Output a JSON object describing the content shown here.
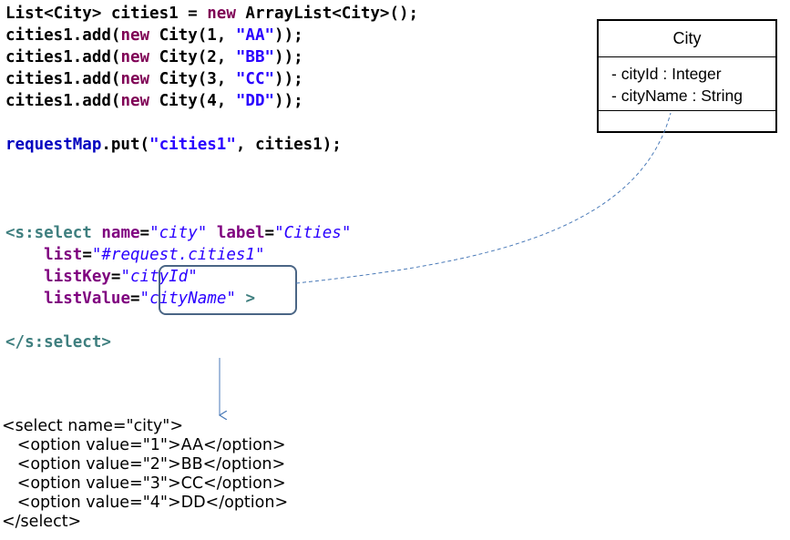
{
  "java": {
    "line1": {
      "a": "List<City> cities1 = ",
      "kw": "new",
      "b": " ArrayList<City>();"
    },
    "adds": [
      {
        "pre": "cities1.add(",
        "kw": "new",
        "mid": " City(1, ",
        "str": "\"AA\"",
        "post": "));"
      },
      {
        "pre": "cities1.add(",
        "kw": "new",
        "mid": " City(2, ",
        "str": "\"BB\"",
        "post": "));"
      },
      {
        "pre": "cities1.add(",
        "kw": "new",
        "mid": " City(3, ",
        "str": "\"CC\"",
        "post": "));"
      },
      {
        "pre": "cities1.add(",
        "kw": "new",
        "mid": " City(4, ",
        "str": "\"DD\"",
        "post": "));"
      }
    ],
    "put": {
      "var": "requestMap",
      "a": ".put(",
      "str": "\"cities1\"",
      "b": ", cities1);"
    }
  },
  "jsp": {
    "open_tag": "<s:select",
    "name_attr": "name",
    "name_val": "\"city\"",
    "label_attr": "label",
    "label_val": "\"Cities\"",
    "list_attr": "list",
    "list_val": "\"#request.cities1\"",
    "listkey_attr": "listKey",
    "listkey_val": "\"cityId\"",
    "listvalue_attr": "listValue",
    "listvalue_val": "\"cityName\"",
    "tag_end": ">",
    "close_tag": "</s:select>"
  },
  "uml": {
    "class_name": "City",
    "attributes": [
      "- cityId : Integer",
      "- cityName : String"
    ]
  },
  "html_output": [
    "<select name=\"city\">",
    "   <option value=\"1\">AA</option>",
    "   <option value=\"2\">BB</option>",
    "   <option value=\"3\">CC</option>",
    "   <option value=\"4\">DD</option>",
    "</select>"
  ],
  "colors": {
    "keyword": "#7f0055",
    "string": "#2a00ff",
    "tag": "#3f7f7f",
    "attribute": "#7f007f",
    "highlight_box": "#4a6585",
    "connector": "#4a7ab8"
  }
}
